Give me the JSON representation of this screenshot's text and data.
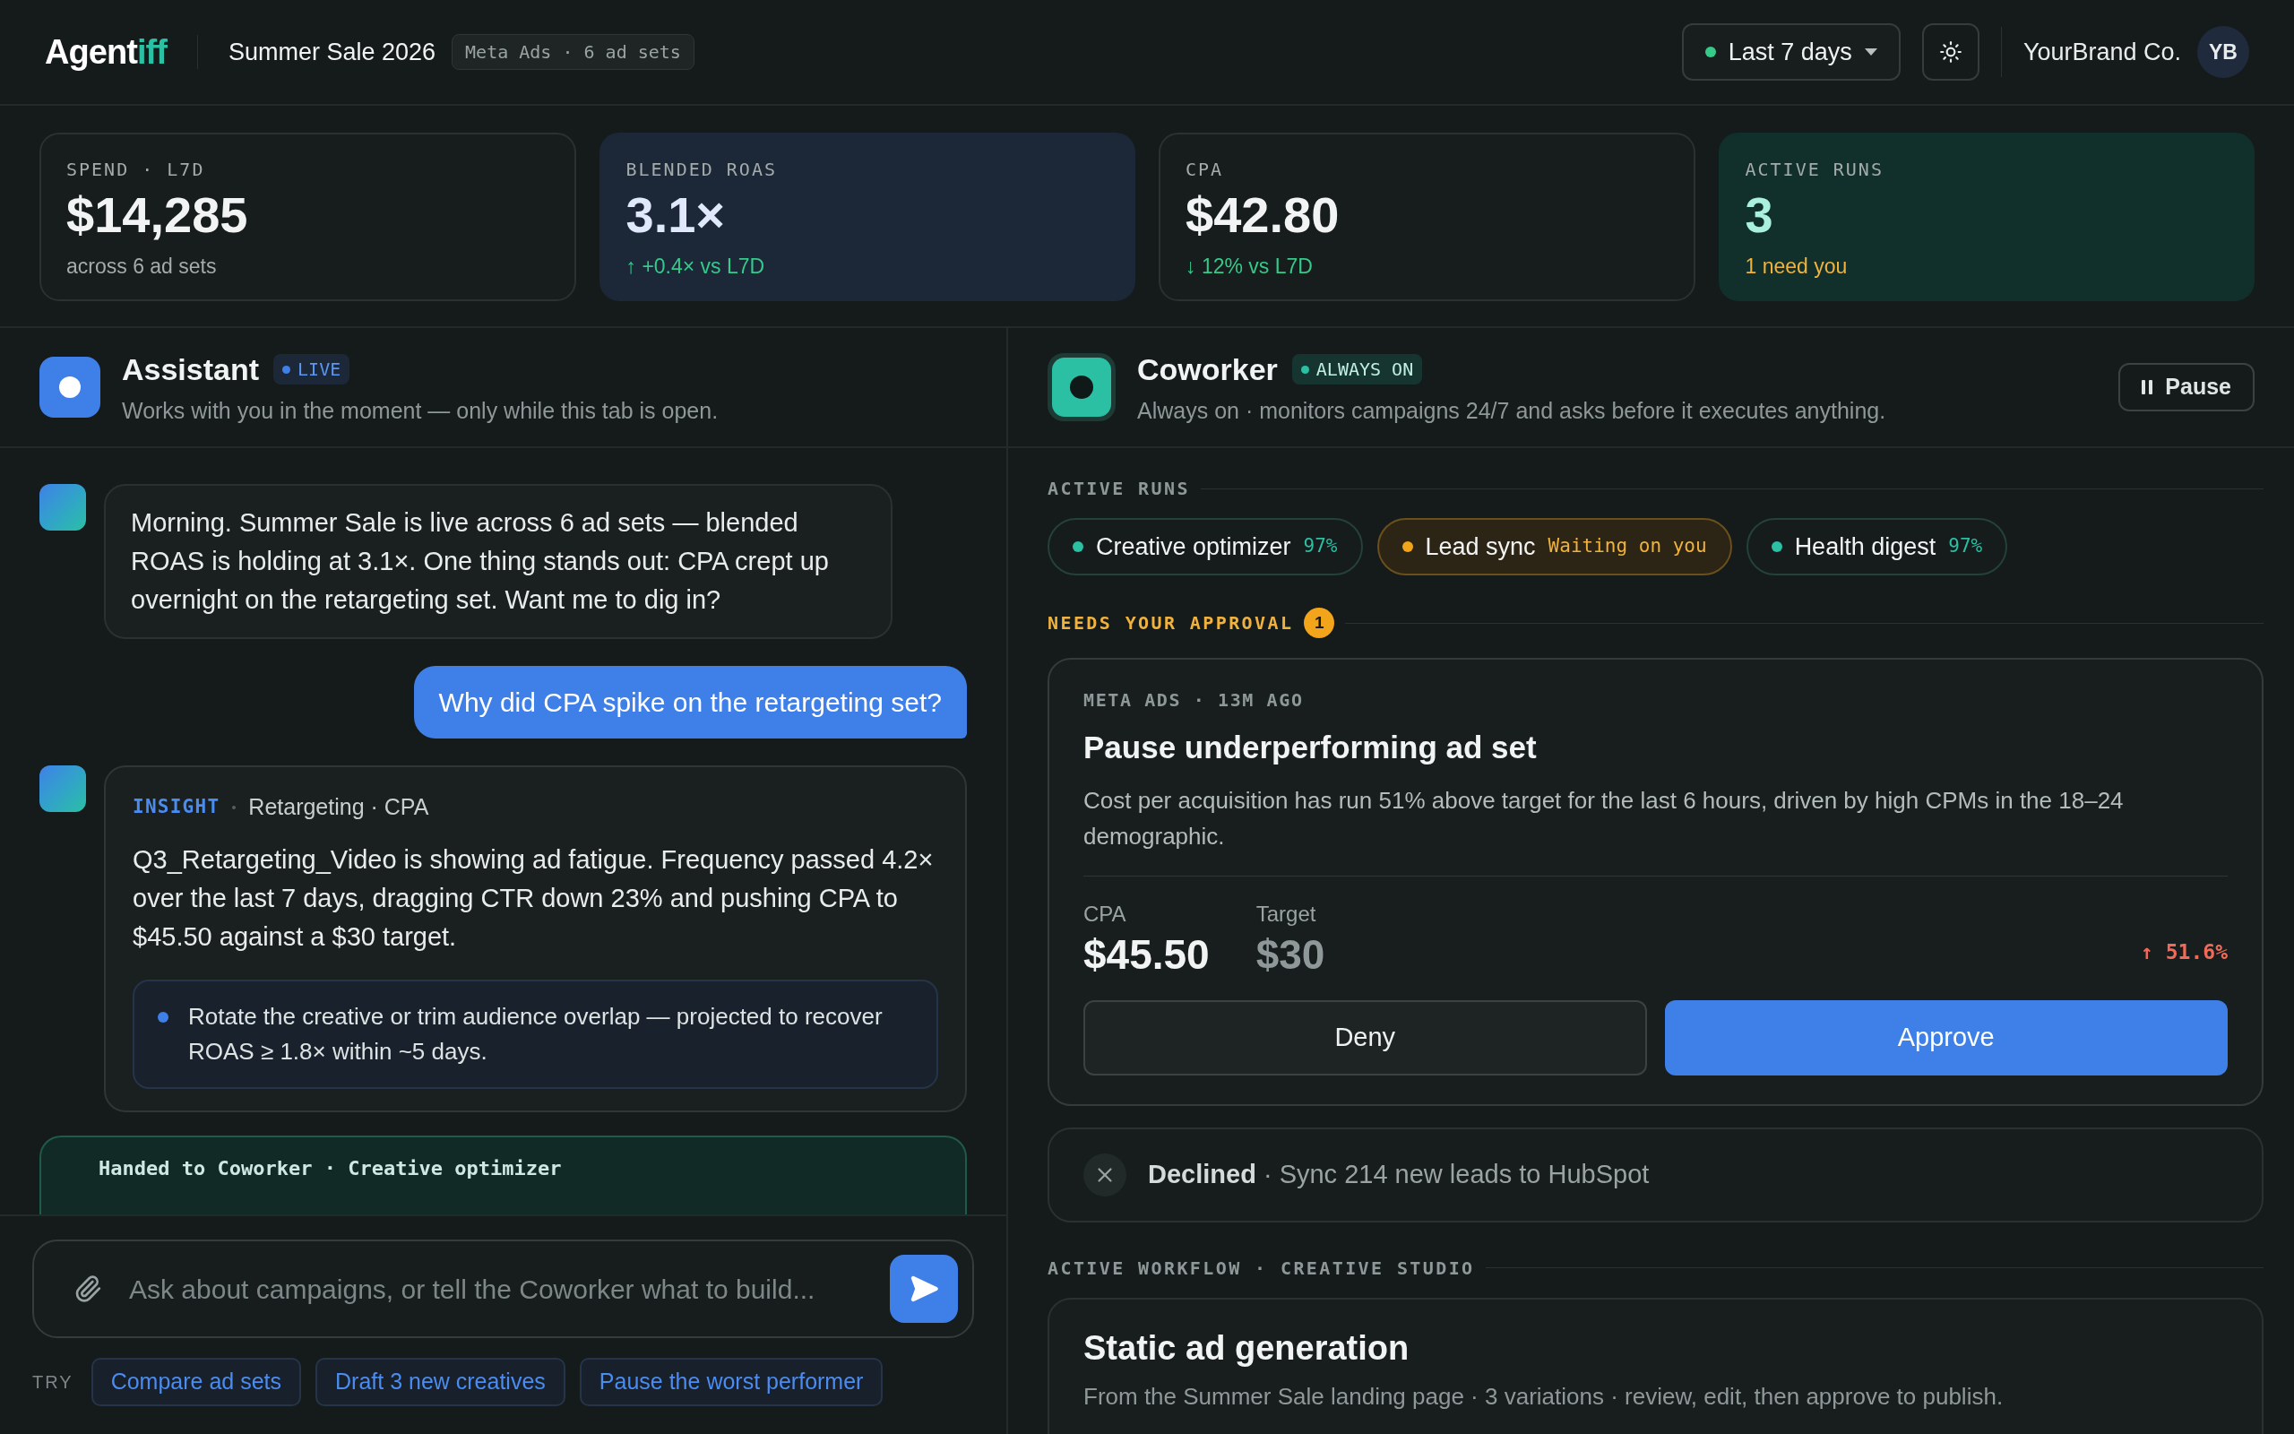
{
  "header": {
    "logo_main": "Agent",
    "logo_accent": "iff",
    "campaign": "Summer Sale 2026",
    "campaign_meta": "Meta Ads · 6 ad sets",
    "date_range": "Last 7 days",
    "account": "YourBrand Co.",
    "avatar_initials": "YB"
  },
  "kpis": [
    {
      "label": "SPEND · L7D",
      "value": "$14,285",
      "note": "across 6 ad sets",
      "kind": "plain",
      "color": "#a3abab"
    },
    {
      "label": "BLENDED ROAS",
      "value": "3.1×",
      "note": "↑ +0.4× vs L7D",
      "kind": "blue",
      "color": "#35c98a"
    },
    {
      "label": "CPA",
      "value": "$42.80",
      "note": "↓ 12% vs L7D",
      "kind": "plain",
      "color": "#35c98a"
    },
    {
      "label": "ACTIVE RUNS",
      "value": "3",
      "note": "1 need you",
      "kind": "teal",
      "color": "#f0b23e"
    }
  ],
  "assistant": {
    "title": "Assistant",
    "badge": "LIVE",
    "subtitle": "Works with you in the moment — only while this tab is open.",
    "messages": [
      {
        "kind": "agent",
        "text": "Morning. Summer Sale is live across 6 ad sets — blended ROAS is holding at 3.1×. One thing stands out: CPA crept up overnight on the retargeting set. Want me to dig in?"
      },
      {
        "kind": "user",
        "text": "Why did CPA spike on the retargeting set?"
      },
      {
        "kind": "insight",
        "tag": "INSIGHT",
        "context": "Retargeting · CPA",
        "text": "Q3_Retargeting_Video is showing ad fatigue. Frequency passed 4.2× over the last 7 days, dragging CTR down 23% and pushing CPA to $45.50 against a $30 target.",
        "recommendation": "Rotate the creative or trim audience overlap — projected to recover ROAS ≥ 1.8× within ~5 days."
      },
      {
        "kind": "handoff",
        "text": "Handed to Coworker · Creative optimizer"
      }
    ],
    "composer": {
      "placeholder": "Ask about campaigns, or tell the Coworker what to build...",
      "try_label": "TRY",
      "suggestions": [
        "Compare ad sets",
        "Draft 3 new creatives",
        "Pause the worst performer"
      ]
    }
  },
  "coworker": {
    "title": "Coworker",
    "badge": "ALWAYS ON",
    "subtitle": "Always on · monitors campaigns 24/7 and asks before it executes anything.",
    "pause_button": "Pause",
    "runs_label": "ACTIVE RUNS",
    "runs": [
      {
        "name": "Creative optimizer",
        "status": "97%",
        "kind": "running"
      },
      {
        "name": "Lead sync",
        "status": "Waiting on you",
        "kind": "waiting"
      },
      {
        "name": "Health digest",
        "status": "97%",
        "kind": "running"
      }
    ],
    "approval": {
      "label": "NEEDS YOUR APPROVAL",
      "count": "1",
      "meta": "META ADS · 13M AGO",
      "title": "Pause underperforming ad set",
      "description": "Cost per acquisition has run 51% above target for the last 6 hours, driven by high CPMs in the 18–24 demographic.",
      "metrics": [
        {
          "label": "CPA",
          "value": "$45.50",
          "kind": "actual"
        },
        {
          "label": "Target",
          "value": "$30",
          "kind": "target"
        }
      ],
      "delta": "↑ 51.6%",
      "deny": "Deny",
      "approve": "Approve"
    },
    "declined": {
      "text": "**Declined** · Sync 214 new leads to HubSpot"
    },
    "workflow": {
      "label": "ACTIVE WORKFLOW · CREATIVE STUDIO",
      "title": "Static ad generation",
      "subtitle": "From the Summer Sale landing page · 3 variations · review, edit, then approve to publish."
    }
  }
}
